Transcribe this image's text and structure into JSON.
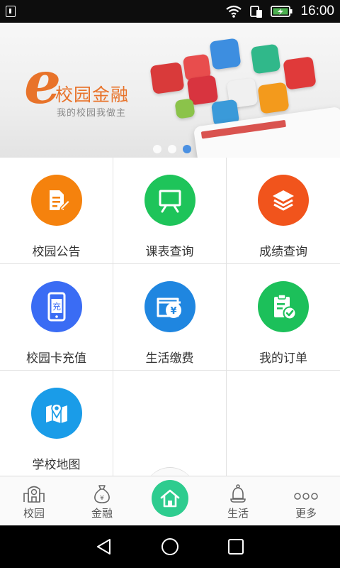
{
  "status_bar": {
    "time": "16:00",
    "icons": [
      "sim-card-icon",
      "wifi-icon",
      "data-sim-icon",
      "battery-charging-icon"
    ],
    "background": "#0d0d0d"
  },
  "banner": {
    "logo_letter": "e",
    "title": "校园金融",
    "slogan": "我的校园我做主",
    "accent_color": "#e8732a",
    "slides_total": 3,
    "active_slide": 3,
    "dot_active_color": "#4a90e2"
  },
  "grid": {
    "items": [
      {
        "label": "校园公告",
        "icon": "notice-edit-icon",
        "color": "#f5820d"
      },
      {
        "label": "课表查询",
        "icon": "blackboard-icon",
        "color": "#1ec45a"
      },
      {
        "label": "成绩查询",
        "icon": "layers-icon",
        "color": "#f1541c"
      },
      {
        "label": "校园卡充值",
        "icon": "phone-recharge-icon",
        "color": "#3a6cf4"
      },
      {
        "label": "生活缴费",
        "icon": "wallet-yuan-icon",
        "color": "#1f86e0"
      },
      {
        "label": "我的订单",
        "icon": "clipboard-check-icon",
        "color": "#1cc05a"
      },
      {
        "label": "学校地图",
        "icon": "map-pin-icon",
        "color": "#1a9ce8"
      }
    ],
    "recharge_glyph": "充",
    "wallet_glyph": "¥"
  },
  "bottom_nav": {
    "items": [
      {
        "label": "校园",
        "icon": "campus-icon"
      },
      {
        "label": "金融",
        "icon": "money-bag-icon"
      },
      {
        "label": "",
        "icon": "home-icon"
      },
      {
        "label": "生活",
        "icon": "bell-icon"
      },
      {
        "label": "更多",
        "icon": "more-dots-icon"
      }
    ],
    "home_color": "#2ecc8f",
    "money_bag_glyph": "¥"
  }
}
